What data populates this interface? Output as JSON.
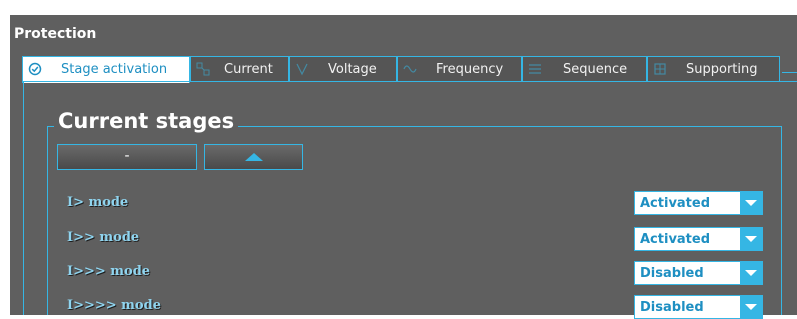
{
  "window": {
    "title": "Protection"
  },
  "tabs": [
    {
      "label": "Stage activation",
      "icon": "check-circle-icon",
      "active": true
    },
    {
      "label": "Current",
      "icon": "current-icon",
      "active": false
    },
    {
      "label": "Voltage",
      "icon": "voltage-icon",
      "active": false
    },
    {
      "label": "Frequency",
      "icon": "frequency-icon",
      "active": false
    },
    {
      "label": "Sequence",
      "icon": "sequence-icon",
      "active": false
    },
    {
      "label": "Supporting",
      "icon": "supporting-icon",
      "active": false
    }
  ],
  "section": {
    "title": "Current stages",
    "minus_button": "-",
    "up_button_icon": "triangle-up-icon"
  },
  "rows": [
    {
      "label": "I> mode",
      "value": "Activated"
    },
    {
      "label": "I>> mode",
      "value": "Activated"
    },
    {
      "label": "I>>> mode",
      "value": "Disabled"
    },
    {
      "label": "I>>>> mode",
      "value": "Disabled"
    }
  ],
  "colors": {
    "accent": "#35b6e4",
    "panel_background": "#5f5f5f",
    "active_tab_text": "#1e8fc2",
    "row_label": "#8fd4ef"
  }
}
